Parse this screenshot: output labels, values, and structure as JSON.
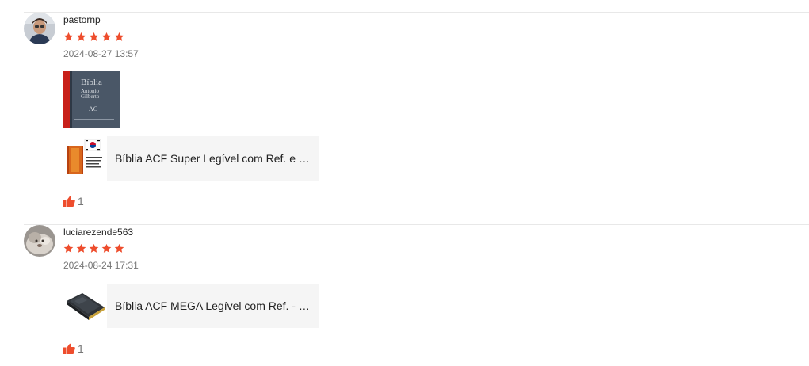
{
  "colors": {
    "star": "#ee4d2d",
    "like": "#ee4d2d",
    "divider": "#e8e8e8",
    "muted": "#767676"
  },
  "reviews": [
    {
      "username": "pastornp",
      "rating": 5,
      "date": "2024-08-27 13:57",
      "has_photo": true,
      "photo_icon": "book-cover-photo",
      "product": {
        "name": "Bíblia ACF Super Legível com Ref. e M..."
      },
      "likes": "1"
    },
    {
      "username": "luciarezende563",
      "rating": 5,
      "date": "2024-08-24 17:31",
      "has_photo": false,
      "product": {
        "name": "Bíblia ACF MEGA Legível com Ref. - Pr..."
      },
      "likes": "1"
    }
  ]
}
